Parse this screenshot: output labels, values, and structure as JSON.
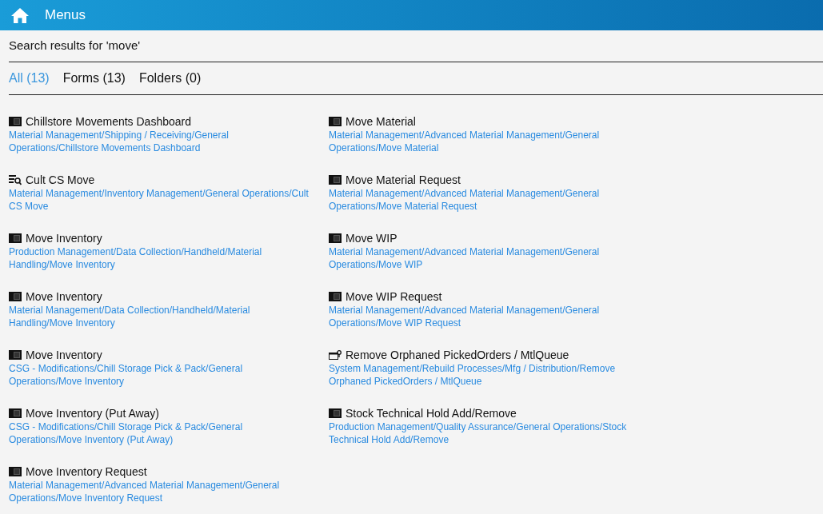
{
  "header": {
    "title": "Menus"
  },
  "search_heading": "Search results for 'move'",
  "tabs": [
    {
      "label": "All (13)",
      "selected": true
    },
    {
      "label": "Forms (13)",
      "selected": false
    },
    {
      "label": "Folders (0)",
      "selected": false
    }
  ],
  "results": [
    {
      "kind": "form",
      "title": "Chillstore Movements Dashboard",
      "path": "Material Management/Shipping / Receiving/General Operations/Chillstore Movements Dashboard"
    },
    {
      "kind": "search",
      "title": "Cult CS Move",
      "path": "Material Management/Inventory Management/General Operations/Cult CS Move"
    },
    {
      "kind": "form",
      "title": "Move Inventory",
      "path": "Production Management/Data Collection/Handheld/Material Handling/Move Inventory"
    },
    {
      "kind": "form",
      "title": "Move Inventory",
      "path": "Material Management/Data Collection/Handheld/Material Handling/Move Inventory"
    },
    {
      "kind": "form",
      "title": "Move Inventory",
      "path": "CSG - Modifications/Chill Storage Pick & Pack/General Operations/Move Inventory"
    },
    {
      "kind": "form",
      "title": "Move Inventory (Put Away)",
      "path": "CSG - Modifications/Chill Storage Pick & Pack/General Operations/Move Inventory (Put Away)"
    },
    {
      "kind": "form",
      "title": "Move Inventory Request",
      "path": "Material Management/Advanced Material Management/General Operations/Move Inventory Request"
    },
    {
      "kind": "form",
      "title": "Move Material",
      "path": "Material Management/Advanced Material Management/General Operations/Move Material"
    },
    {
      "kind": "form",
      "title": "Move Material Request",
      "path": "Material Management/Advanced Material Management/General Operations/Move Material Request"
    },
    {
      "kind": "form",
      "title": "Move WIP",
      "path": "Material Management/Advanced Material Management/General Operations/Move WIP"
    },
    {
      "kind": "form",
      "title": "Move WIP Request",
      "path": "Material Management/Advanced Material Management/General Operations/Move WIP Request"
    },
    {
      "kind": "process",
      "title": "Remove Orphaned PickedOrders / MtlQueue",
      "path": "System Management/Rebuild Processes/Mfg / Distribution/Remove Orphaned PickedOrders / MtlQueue"
    },
    {
      "kind": "form",
      "title": "Stock Technical Hold Add/Remove",
      "path": "Production Management/Quality Assurance/General Operations/Stock Technical Hold Add/Remove"
    }
  ]
}
